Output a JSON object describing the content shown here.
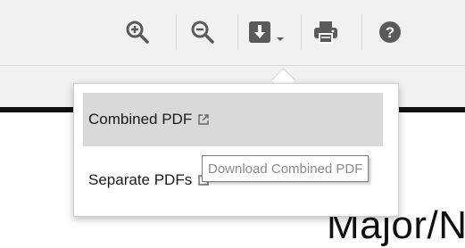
{
  "toolbar": {
    "buttons": [
      {
        "icon": "zoom-in-icon"
      },
      {
        "icon": "zoom-out-icon"
      },
      {
        "icon": "download-dropdown-icon"
      },
      {
        "icon": "print-icon"
      },
      {
        "icon": "help-icon"
      }
    ]
  },
  "download_menu": {
    "items": [
      {
        "label": "Combined PDF",
        "icon": "external-link-icon"
      },
      {
        "label": "Separate PDFs",
        "icon": "external-link-icon"
      }
    ]
  },
  "tooltip": {
    "text": "Download Combined PDF"
  },
  "document": {
    "heading_fragment": "Major/N"
  },
  "colors": {
    "toolbar_bg": "#f1f1f1",
    "icon": "#5a5a5a",
    "menu_hover": "#d9d9d9"
  }
}
